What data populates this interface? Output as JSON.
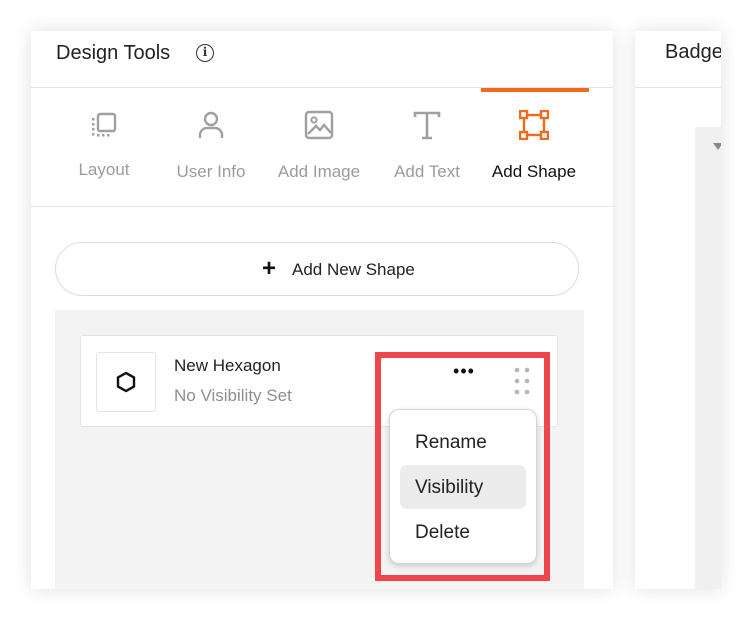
{
  "header": {
    "title": "Design Tools",
    "info_icon": "info-icon"
  },
  "tabs": [
    {
      "label": "Layout",
      "icon": "layout-icon",
      "active": false
    },
    {
      "label": "User Info",
      "icon": "user-icon",
      "active": false
    },
    {
      "label": "Add Image",
      "icon": "image-icon",
      "active": false
    },
    {
      "label": "Add Text",
      "icon": "text-icon",
      "active": false
    },
    {
      "label": "Add Shape",
      "icon": "shape-icon",
      "active": true
    }
  ],
  "add_button": {
    "label": "Add New Shape",
    "icon": "plus-icon"
  },
  "shape_item": {
    "name": "New Hexagon",
    "subtitle": "No Visibility Set",
    "icon": "hexagon-icon",
    "more_icon": "more-horizontal-icon",
    "drag_icon": "drag-handle-icon"
  },
  "context_menu": {
    "items": [
      {
        "label": "Rename"
      },
      {
        "label": "Visibility",
        "hovered": true
      },
      {
        "label": "Delete"
      }
    ]
  },
  "right_panel": {
    "title": "Badge"
  },
  "colors": {
    "accent": "#f26a1b",
    "highlight": "#f1454e",
    "inactive_text": "#9b9b9b"
  }
}
